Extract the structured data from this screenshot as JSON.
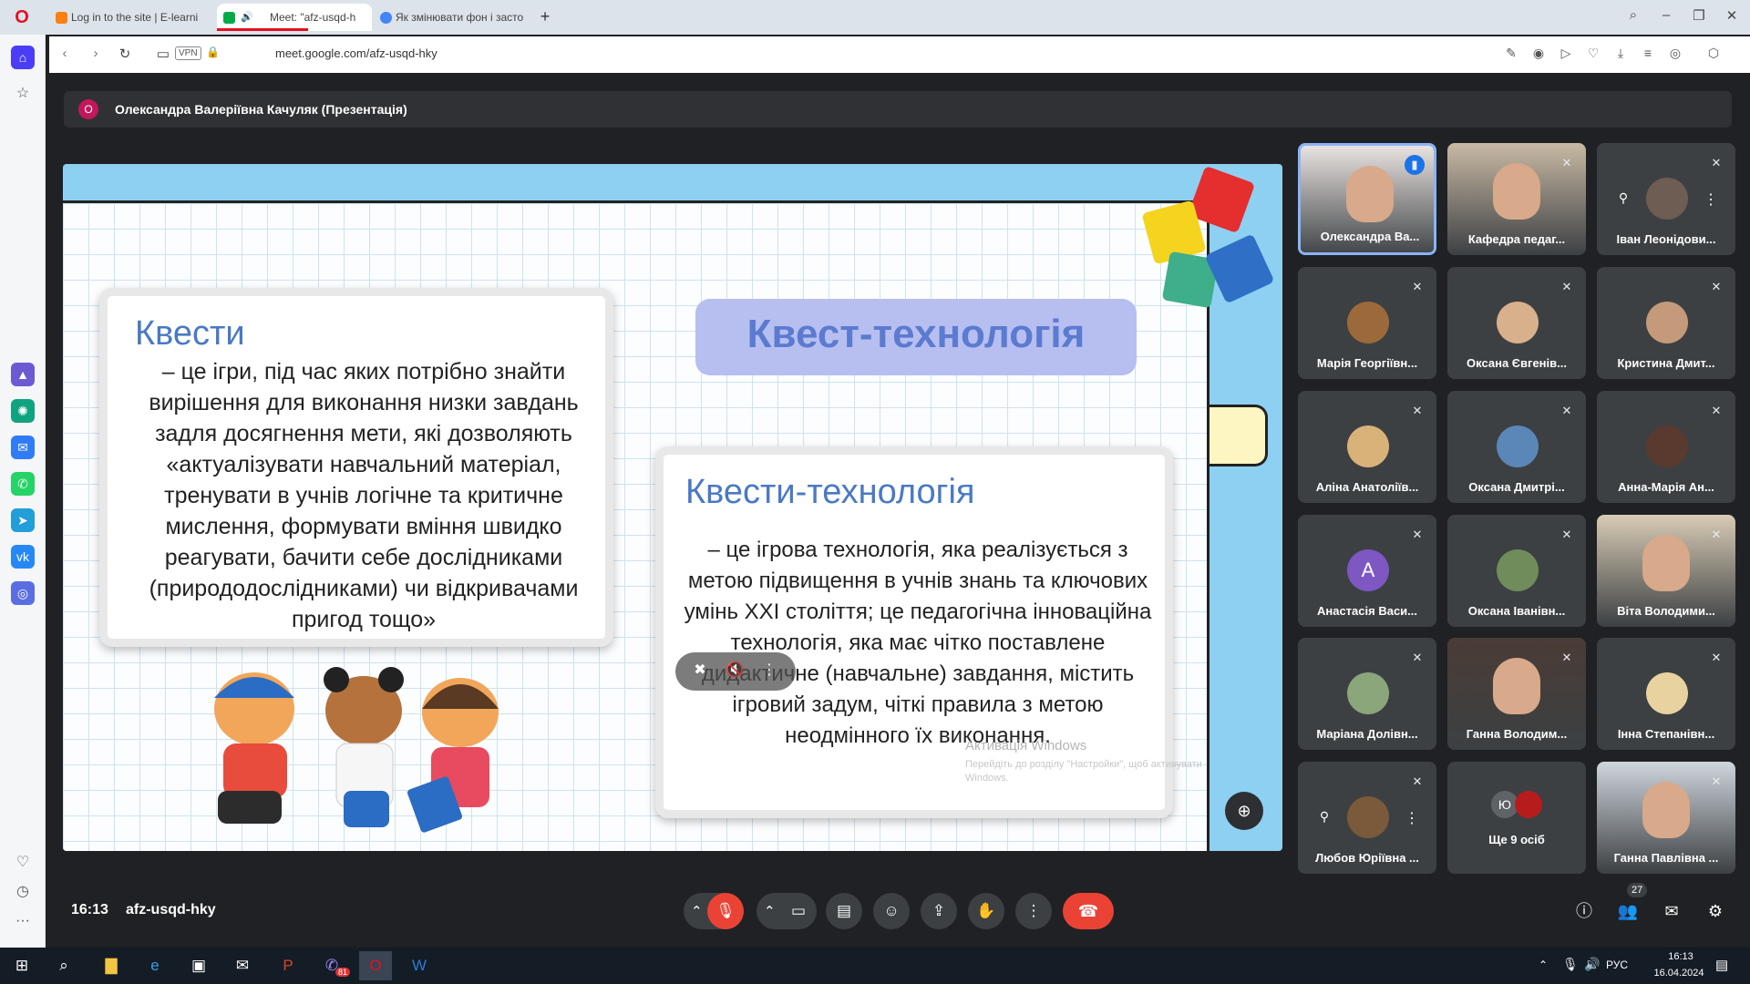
{
  "browser": {
    "tabs": [
      {
        "label": "Log in to the site | E-learni",
        "icon_color": "#f98012"
      },
      {
        "label": "Meet: \"afz-usqd-h",
        "icon_color": "#00ac47"
      },
      {
        "label": "Як змінювати фон і засто",
        "icon_color": "#4285f4"
      }
    ],
    "url": "meet.google.com/afz-usqd-hky",
    "vpn_label": "VPN"
  },
  "meet": {
    "presenter_initial": "О",
    "presenter_name": "Олександра Валеріївна Качуляк (Презентація)",
    "time": "16:13",
    "meeting_code": "afz-usqd-hky",
    "people_count": "27"
  },
  "slide": {
    "heading": "Квест-технологія",
    "card1_title": "Квести",
    "card1_text": "– це ігри, під час яких потрібно знайти вирішення для виконання низки завдань задля досягнення мети, які дозволяють «актуалізувати навчальний матеріал, тренувати в учнів логічне та критичне мислення, формувати вміння швидко реагувати, бачити себе дослідниками (природодослідниками) чи відкривачами пригод тощо»",
    "card2_title": "Квести-технологія",
    "card2_text": "– це ігрова технологія, яка реалізується з метою підвищення в учнів знань та ключових умінь XXI століття; це педагогічна інноваційна технологія, яка має чітко поставлене дидактичне (навчальне) завдання, містить ігровий задум, чіткі правила з метою неодмінного їх виконання.",
    "watermark": "Активація Windows",
    "watermark_sub": "Перейдіть до розділу \"Настройки\", щоб активувати Windows."
  },
  "participants": [
    {
      "name": "Олександра Ва...",
      "type": "video",
      "speaking": true,
      "color": "#e9e3e0"
    },
    {
      "name": "Кафедра педаг...",
      "type": "video",
      "color": "#c9b9a4"
    },
    {
      "name": "Іван Леонідови...",
      "type": "avatar",
      "pinned": true,
      "color": "#6d5d52"
    },
    {
      "name": "Марія Георгіївн...",
      "type": "avatar",
      "color": "#9c6a3a"
    },
    {
      "name": "Оксана Євгенів...",
      "type": "avatar",
      "color": "#d9b08c"
    },
    {
      "name": "Кристина Дмит...",
      "type": "avatar",
      "color": "#c49a7a"
    },
    {
      "name": "Аліна Анатоліїв...",
      "type": "avatar",
      "color": "#d9b27a"
    },
    {
      "name": "Оксана Дмитрі...",
      "type": "avatar",
      "color": "#5b86b8"
    },
    {
      "name": "Анна-Марія Ан...",
      "type": "avatar",
      "color": "#5a3a2e"
    },
    {
      "name": "Анастасія Васи...",
      "type": "letter",
      "letter": "A",
      "color": "#7e57c2"
    },
    {
      "name": "Оксана Іванівн...",
      "type": "avatar",
      "color": "#6f8c5a"
    },
    {
      "name": "Віта Володими...",
      "type": "video",
      "color": "#d8cbb5"
    },
    {
      "name": "Маріана Долівн...",
      "type": "avatar",
      "color": "#8aa67a"
    },
    {
      "name": "Ганна Володим...",
      "type": "video",
      "color": "#4a3c36"
    },
    {
      "name": "Інна Степанівн...",
      "type": "avatar",
      "color": "#e8d2a0"
    },
    {
      "name": "Любов Юріївна ...",
      "type": "avatar",
      "pinned": true,
      "color": "#7a5a3a"
    },
    {
      "name": "Ще 9 осіб",
      "type": "more",
      "letter": "Ю"
    },
    {
      "name": "Ганна Павлівна ...",
      "type": "video",
      "color": "#cfd6dc"
    }
  ],
  "taskbar": {
    "lang": "РУС",
    "time": "16:13",
    "date": "16.04.2024",
    "app_badge": "81"
  },
  "colors": {
    "accent": "#8ab4f8",
    "danger": "#ea4335",
    "tile": "#3c4043"
  }
}
